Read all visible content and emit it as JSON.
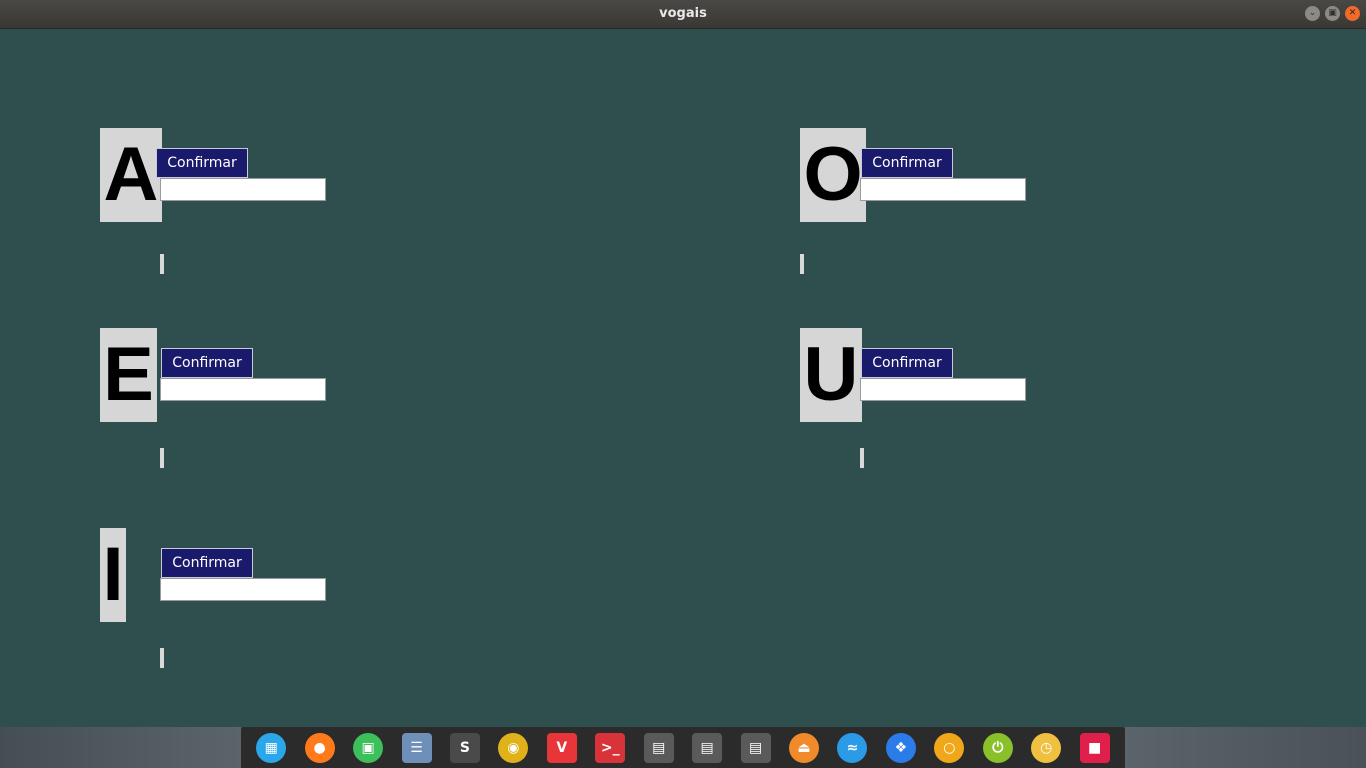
{
  "window": {
    "title": "vogais"
  },
  "vowels": [
    {
      "letter": "A",
      "button_label": "Confirmar",
      "entry_value": ""
    },
    {
      "letter": "E",
      "button_label": "Confirmar",
      "entry_value": ""
    },
    {
      "letter": "I",
      "button_label": "Confirmar",
      "entry_value": ""
    },
    {
      "letter": "O",
      "button_label": "Confirmar",
      "entry_value": ""
    },
    {
      "letter": "U",
      "button_label": "Confirmar",
      "entry_value": ""
    }
  ],
  "colors": {
    "background": "#2f4f4f",
    "button": "#1a1a6c",
    "letter_box": "#d6d6d6"
  },
  "dock": {
    "items": [
      {
        "icon": "launcher-icon",
        "color": "#2aa7e8"
      },
      {
        "icon": "firefox-icon",
        "color": "#ff7a1a"
      },
      {
        "icon": "app-store-icon",
        "color": "#3dbf5c"
      },
      {
        "icon": "file-manager-icon",
        "color": "#6d8fb8"
      },
      {
        "icon": "sublime-text-icon",
        "color": "#4a4a4a"
      },
      {
        "icon": "chrome-icon",
        "color": "#e0b21a"
      },
      {
        "icon": "vivaldi-icon",
        "color": "#e8353a"
      },
      {
        "icon": "terminal-icon",
        "color": "#d9333a"
      },
      {
        "icon": "document-icon",
        "color": "#5a5a5a"
      },
      {
        "icon": "document-icon",
        "color": "#5a5a5a"
      },
      {
        "icon": "document-icon",
        "color": "#5a5a5a"
      },
      {
        "icon": "eject-icon",
        "color": "#f08a2a"
      },
      {
        "icon": "wifi-icon",
        "color": "#2b9be8"
      },
      {
        "icon": "dropbox-icon",
        "color": "#2b7be8"
      },
      {
        "icon": "search-ring-icon",
        "color": "#f0a81a"
      },
      {
        "icon": "power-icon",
        "color": "#8ac02a"
      },
      {
        "icon": "clock-icon",
        "color": "#f0c040"
      },
      {
        "icon": "trash-folder-icon",
        "color": "#e0204a"
      }
    ]
  }
}
